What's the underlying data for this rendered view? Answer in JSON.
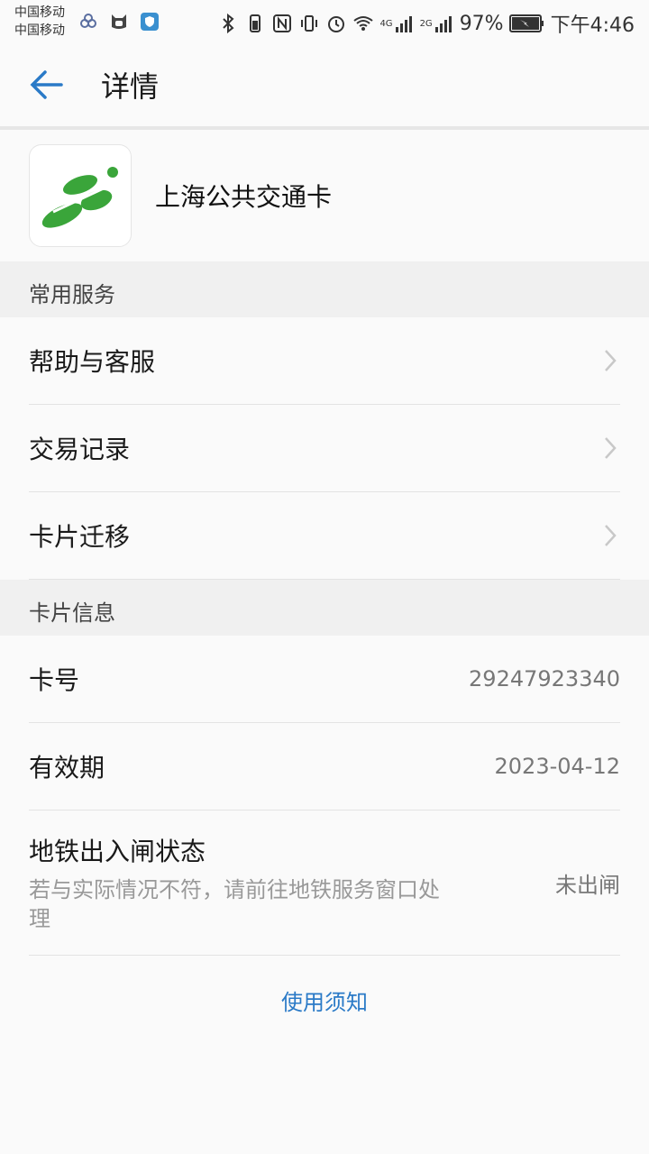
{
  "statusbar": {
    "carrier1": "中国移动",
    "carrier2": "中国移动",
    "battery_pct": "97%",
    "time": "下午4:46",
    "net1": "4G",
    "net2": "2G"
  },
  "header": {
    "title": "详情"
  },
  "card": {
    "name": "上海公共交通卡"
  },
  "sections": {
    "common_services": "常用服务",
    "card_info": "卡片信息"
  },
  "services": [
    {
      "label": "帮助与客服"
    },
    {
      "label": "交易记录"
    },
    {
      "label": "卡片迁移"
    }
  ],
  "info": {
    "card_number_label": "卡号",
    "card_number": "29247923340",
    "expiry_label": "有效期",
    "expiry": "2023-04-12",
    "gate_status_label": "地铁出入闸状态",
    "gate_status_hint": "若与实际情况不符，请前往地铁服务窗口处理",
    "gate_status": "未出闸"
  },
  "notice_link": "使用须知",
  "colors": {
    "accent": "#2a7ac7",
    "logo_green": "#3aa53a"
  }
}
